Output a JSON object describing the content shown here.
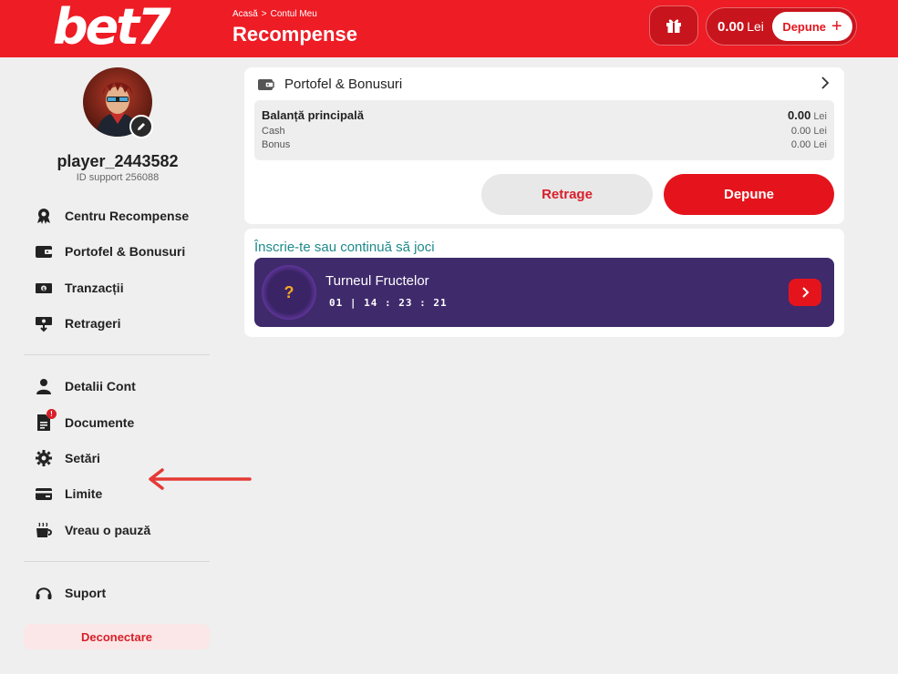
{
  "header": {
    "logo": "bet7",
    "breadcrumb": [
      "Acasă",
      "Contul Meu"
    ],
    "breadcrumb_sep": ">",
    "title": "Recompense",
    "balance_amount": "0.00",
    "balance_currency": "Lei",
    "deposit_label": "Depune",
    "brand_color": "#ee1c25"
  },
  "profile": {
    "username": "player_2443582",
    "support_id": "ID support 256088"
  },
  "sidebar": {
    "group1": [
      {
        "label": "Centru Recompense",
        "icon": "award-icon"
      },
      {
        "label": "Portofel & Bonusuri",
        "icon": "wallet-icon"
      },
      {
        "label": "Tranzacții",
        "icon": "money-icon"
      },
      {
        "label": "Retrageri",
        "icon": "withdraw-icon"
      }
    ],
    "group2": [
      {
        "label": "Detalii Cont",
        "icon": "user-icon"
      },
      {
        "label": "Documente",
        "icon": "document-icon",
        "badge": "!"
      },
      {
        "label": "Setări",
        "icon": "gear-icon"
      },
      {
        "label": "Limite",
        "icon": "card-icon"
      },
      {
        "label": "Vreau o pauză",
        "icon": "coffee-icon"
      }
    ],
    "group3": [
      {
        "label": "Suport",
        "icon": "headset-icon"
      }
    ],
    "logout": "Deconectare"
  },
  "wallet": {
    "title": "Portofel & Bonusuri",
    "main_label": "Balanță principală",
    "main_amount": "0.00",
    "currency": "Lei",
    "rows": [
      {
        "label": "Cash",
        "amount": "0.00"
      },
      {
        "label": "Bonus",
        "amount": "0.00"
      }
    ],
    "withdraw_label": "Retrage",
    "deposit_label": "Depune"
  },
  "tournament": {
    "heading": "Înscrie-te sau continuă să joci",
    "name": "Turneul Fructelor",
    "timer": "01 | 14 : 23 : 21",
    "badge": "?",
    "banner_color": "#3f2a6c"
  }
}
